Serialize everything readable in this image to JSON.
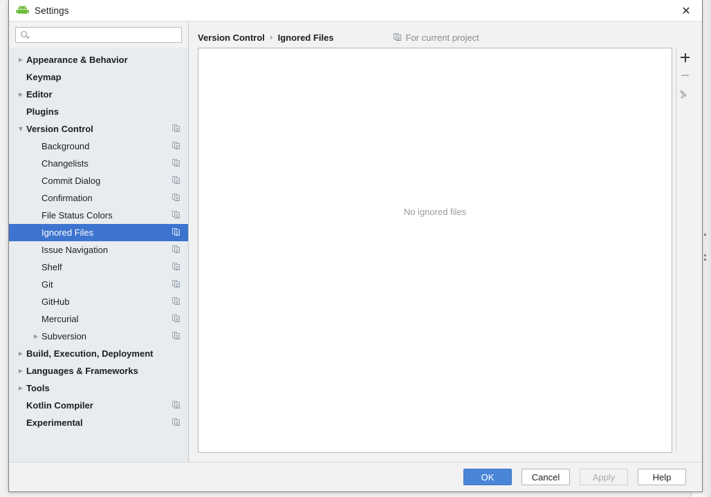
{
  "window": {
    "title": "Settings",
    "app_icon": "android-robot-icon",
    "close_icon": "close-icon",
    "close_glyph": "✕"
  },
  "search": {
    "icon": "search-icon",
    "value": "",
    "placeholder": ""
  },
  "sidebar": {
    "items": [
      {
        "label": "Appearance & Behavior",
        "level": 0,
        "arrow": "collapsed",
        "copy_icon": false,
        "selected": false
      },
      {
        "label": "Keymap",
        "level": 0,
        "arrow": "none",
        "copy_icon": false,
        "selected": false
      },
      {
        "label": "Editor",
        "level": 0,
        "arrow": "collapsed",
        "copy_icon": false,
        "selected": false
      },
      {
        "label": "Plugins",
        "level": 0,
        "arrow": "none",
        "copy_icon": false,
        "selected": false
      },
      {
        "label": "Version Control",
        "level": 0,
        "arrow": "expanded",
        "copy_icon": true,
        "selected": false
      },
      {
        "label": "Background",
        "level": 1,
        "arrow": "none",
        "copy_icon": true,
        "selected": false
      },
      {
        "label": "Changelists",
        "level": 1,
        "arrow": "none",
        "copy_icon": true,
        "selected": false
      },
      {
        "label": "Commit Dialog",
        "level": 1,
        "arrow": "none",
        "copy_icon": true,
        "selected": false
      },
      {
        "label": "Confirmation",
        "level": 1,
        "arrow": "none",
        "copy_icon": true,
        "selected": false
      },
      {
        "label": "File Status Colors",
        "level": 1,
        "arrow": "none",
        "copy_icon": true,
        "selected": false
      },
      {
        "label": "Ignored Files",
        "level": 1,
        "arrow": "none",
        "copy_icon": true,
        "selected": true
      },
      {
        "label": "Issue Navigation",
        "level": 1,
        "arrow": "none",
        "copy_icon": true,
        "selected": false
      },
      {
        "label": "Shelf",
        "level": 1,
        "arrow": "none",
        "copy_icon": true,
        "selected": false
      },
      {
        "label": "Git",
        "level": 1,
        "arrow": "none",
        "copy_icon": true,
        "selected": false
      },
      {
        "label": "GitHub",
        "level": 1,
        "arrow": "none",
        "copy_icon": true,
        "selected": false
      },
      {
        "label": "Mercurial",
        "level": 1,
        "arrow": "none",
        "copy_icon": true,
        "selected": false
      },
      {
        "label": "Subversion",
        "level": 1,
        "arrow": "collapsed",
        "copy_icon": true,
        "selected": false
      },
      {
        "label": "Build, Execution, Deployment",
        "level": 0,
        "arrow": "collapsed",
        "copy_icon": false,
        "selected": false
      },
      {
        "label": "Languages & Frameworks",
        "level": 0,
        "arrow": "collapsed",
        "copy_icon": false,
        "selected": false
      },
      {
        "label": "Tools",
        "level": 0,
        "arrow": "collapsed",
        "copy_icon": false,
        "selected": false
      },
      {
        "label": "Kotlin Compiler",
        "level": 0,
        "arrow": "none",
        "copy_icon": true,
        "selected": false
      },
      {
        "label": "Experimental",
        "level": 0,
        "arrow": "none",
        "copy_icon": true,
        "selected": false
      }
    ]
  },
  "main": {
    "breadcrumb": {
      "parent": "Version Control",
      "separator": "›",
      "current": "Ignored Files"
    },
    "scope_note": {
      "icon": "copy-icon",
      "text": "For current project"
    },
    "empty_state": "No ignored files",
    "toolbar": {
      "add_label": "+",
      "remove_label": "−",
      "edit_icon": "pencil-icon"
    }
  },
  "footer": {
    "ok_label": "OK",
    "cancel_label": "Cancel",
    "apply_label": "Apply",
    "help_label": "Help"
  },
  "colors": {
    "selection_blue": "#3d74cf",
    "primary_button": "#4a86d8",
    "sidebar_bg": "#e8ecef",
    "dialog_bg": "#f2f2f2",
    "muted_text": "#9a9a9a"
  }
}
